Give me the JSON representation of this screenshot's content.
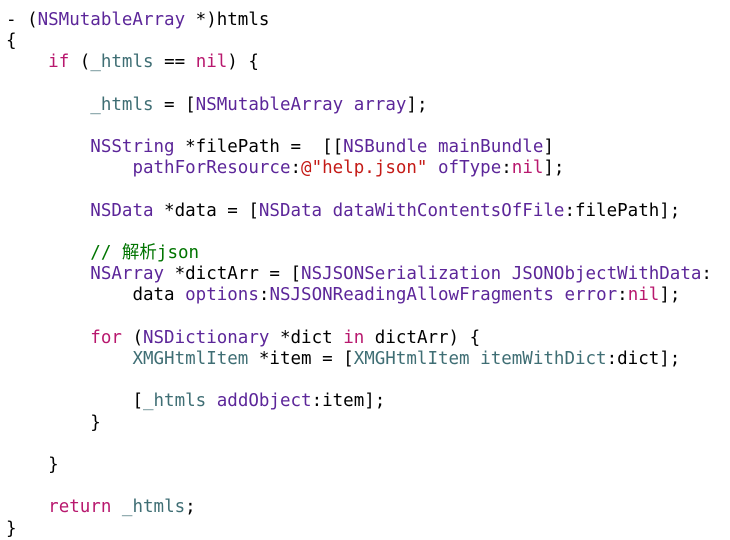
{
  "editor": {
    "colors": {
      "plain": "#000000",
      "keyword": "#b8186e",
      "class": "#5c2699",
      "method": "#3f6e74",
      "ivar": "#3f6e74",
      "string": "#c41a16",
      "comment": "#007400",
      "at_sign": "#c41a16"
    },
    "lines": [
      {
        "indent": 0,
        "tokens": [
          {
            "t": "- (",
            "k": "plain"
          },
          {
            "t": "NSMutableArray",
            "k": "class"
          },
          {
            "t": " *)htmls",
            "k": "plain"
          }
        ]
      },
      {
        "indent": 0,
        "tokens": [
          {
            "t": "{",
            "k": "plain"
          }
        ]
      },
      {
        "indent": 1,
        "tokens": [
          {
            "t": "if",
            "k": "keyword"
          },
          {
            "t": " (",
            "k": "plain"
          },
          {
            "t": "_htmls",
            "k": "ivar"
          },
          {
            "t": " == ",
            "k": "plain"
          },
          {
            "t": "nil",
            "k": "keyword"
          },
          {
            "t": ") {",
            "k": "plain"
          }
        ]
      },
      {
        "indent": 0,
        "tokens": []
      },
      {
        "indent": 2,
        "tokens": [
          {
            "t": "_htmls",
            "k": "ivar"
          },
          {
            "t": " = [",
            "k": "plain"
          },
          {
            "t": "NSMutableArray",
            "k": "class"
          },
          {
            "t": " ",
            "k": "plain"
          },
          {
            "t": "array",
            "k": "class"
          },
          {
            "t": "];",
            "k": "plain"
          }
        ]
      },
      {
        "indent": 0,
        "tokens": []
      },
      {
        "indent": 2,
        "tokens": [
          {
            "t": "NSString",
            "k": "class"
          },
          {
            "t": " *filePath =  [[",
            "k": "plain"
          },
          {
            "t": "NSBundle",
            "k": "class"
          },
          {
            "t": " ",
            "k": "plain"
          },
          {
            "t": "mainBundle",
            "k": "class"
          },
          {
            "t": "]",
            "k": "plain"
          }
        ]
      },
      {
        "indent": 3,
        "tokens": [
          {
            "t": "pathForResource",
            "k": "class"
          },
          {
            "t": ":",
            "k": "plain"
          },
          {
            "t": "@\"help.json\"",
            "k": "string"
          },
          {
            "t": " ",
            "k": "plain"
          },
          {
            "t": "ofType",
            "k": "class"
          },
          {
            "t": ":",
            "k": "plain"
          },
          {
            "t": "nil",
            "k": "keyword"
          },
          {
            "t": "];",
            "k": "plain"
          }
        ]
      },
      {
        "indent": 0,
        "tokens": []
      },
      {
        "indent": 2,
        "tokens": [
          {
            "t": "NSData",
            "k": "class"
          },
          {
            "t": " *data = [",
            "k": "plain"
          },
          {
            "t": "NSData",
            "k": "class"
          },
          {
            "t": " ",
            "k": "plain"
          },
          {
            "t": "dataWithContentsOfFile",
            "k": "class"
          },
          {
            "t": ":filePath];",
            "k": "plain"
          }
        ]
      },
      {
        "indent": 0,
        "tokens": []
      },
      {
        "indent": 2,
        "tokens": [
          {
            "t": "// 解析json",
            "k": "comment"
          }
        ]
      },
      {
        "indent": 2,
        "tokens": [
          {
            "t": "NSArray",
            "k": "class"
          },
          {
            "t": " *dictArr = [",
            "k": "plain"
          },
          {
            "t": "NSJSONSerialization",
            "k": "class"
          },
          {
            "t": " ",
            "k": "plain"
          },
          {
            "t": "JSONObjectWithData",
            "k": "class"
          },
          {
            "t": ":",
            "k": "plain"
          }
        ]
      },
      {
        "indent": 3,
        "tokens": [
          {
            "t": "data ",
            "k": "plain"
          },
          {
            "t": "options",
            "k": "class"
          },
          {
            "t": ":",
            "k": "plain"
          },
          {
            "t": "NSJSONReadingAllowFragments",
            "k": "class"
          },
          {
            "t": " ",
            "k": "plain"
          },
          {
            "t": "error",
            "k": "class"
          },
          {
            "t": ":",
            "k": "plain"
          },
          {
            "t": "nil",
            "k": "keyword"
          },
          {
            "t": "];",
            "k": "plain"
          }
        ]
      },
      {
        "indent": 0,
        "tokens": []
      },
      {
        "indent": 2,
        "tokens": [
          {
            "t": "for",
            "k": "keyword"
          },
          {
            "t": " (",
            "k": "plain"
          },
          {
            "t": "NSDictionary",
            "k": "class"
          },
          {
            "t": " *dict ",
            "k": "plain"
          },
          {
            "t": "in",
            "k": "keyword"
          },
          {
            "t": " dictArr) {",
            "k": "plain"
          }
        ]
      },
      {
        "indent": 3,
        "tokens": [
          {
            "t": "XMGHtmlItem",
            "k": "method"
          },
          {
            "t": " *item = [",
            "k": "plain"
          },
          {
            "t": "XMGHtmlItem",
            "k": "method"
          },
          {
            "t": " ",
            "k": "plain"
          },
          {
            "t": "itemWithDict",
            "k": "method"
          },
          {
            "t": ":dict];",
            "k": "plain"
          }
        ]
      },
      {
        "indent": 0,
        "tokens": []
      },
      {
        "indent": 3,
        "tokens": [
          {
            "t": "[",
            "k": "plain"
          },
          {
            "t": "_htmls",
            "k": "ivar"
          },
          {
            "t": " ",
            "k": "plain"
          },
          {
            "t": "addObject",
            "k": "class"
          },
          {
            "t": ":item];",
            "k": "plain"
          }
        ]
      },
      {
        "indent": 2,
        "tokens": [
          {
            "t": "}",
            "k": "plain"
          }
        ]
      },
      {
        "indent": 0,
        "tokens": []
      },
      {
        "indent": 1,
        "tokens": [
          {
            "t": "}",
            "k": "plain"
          }
        ]
      },
      {
        "indent": 0,
        "tokens": []
      },
      {
        "indent": 1,
        "tokens": [
          {
            "t": "return",
            "k": "keyword"
          },
          {
            "t": " ",
            "k": "plain"
          },
          {
            "t": "_htmls",
            "k": "ivar"
          },
          {
            "t": ";",
            "k": "plain"
          }
        ]
      },
      {
        "indent": 0,
        "tokens": [
          {
            "t": "}",
            "k": "plain"
          }
        ]
      }
    ]
  }
}
